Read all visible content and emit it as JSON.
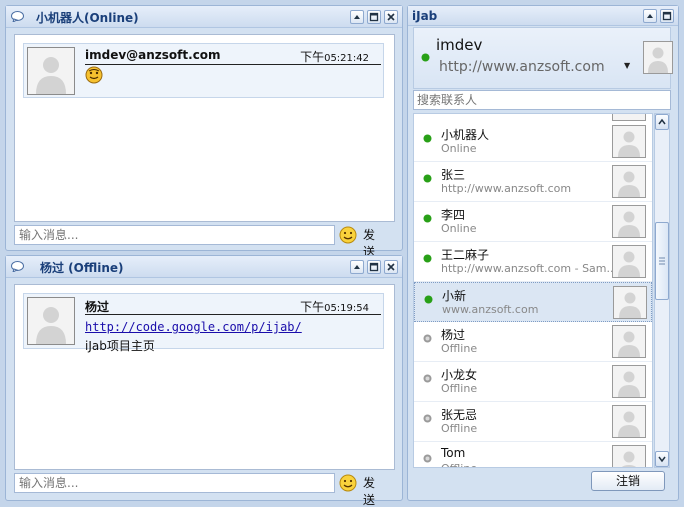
{
  "chat1": {
    "title": "小机器人(Online)",
    "message": {
      "sender": "imdev@anzsoft.com",
      "time_prefix": "下午",
      "time": "05:21:42",
      "emoji": "smiley-icon"
    },
    "input_placeholder": "输入消息...",
    "send_label": "发送"
  },
  "chat2": {
    "title": "杨过 (Offline)",
    "message": {
      "sender": "杨过",
      "time_prefix": "下午",
      "time": "05:19:54",
      "link": "http://code.google.com/p/ijab/",
      "text": "iJab项目主页"
    },
    "input_placeholder": "输入消息...",
    "send_label": "发送"
  },
  "roster": {
    "title": "iJab",
    "user": {
      "name": "imdev",
      "status": "http://www.anzsoft.com"
    },
    "search_placeholder": "搜索联系人",
    "contacts": [
      {
        "name": "小机器人",
        "status": "Online",
        "presence": "online"
      },
      {
        "name": "张三",
        "status": "http://www.anzsoft.com",
        "presence": "online"
      },
      {
        "name": "李四",
        "status": "Online",
        "presence": "online"
      },
      {
        "name": "王二麻子",
        "status": "http://www.anzsoft.com - Sam...",
        "presence": "online"
      },
      {
        "name": "小新",
        "status": "www.anzsoft.com",
        "presence": "online"
      },
      {
        "name": "杨过",
        "status": "Offline",
        "presence": "offline"
      },
      {
        "name": "小龙女",
        "status": "Offline",
        "presence": "offline"
      },
      {
        "name": "张无忌",
        "status": "Offline",
        "presence": "offline"
      },
      {
        "name": "Tom",
        "status": "Offline",
        "presence": "offline"
      }
    ],
    "logout_label": "注销"
  },
  "colors": {
    "online": "#28a017",
    "offline": "#9a9a9a",
    "title_text": "#1a3f7a",
    "background": "#c4d5ea"
  }
}
